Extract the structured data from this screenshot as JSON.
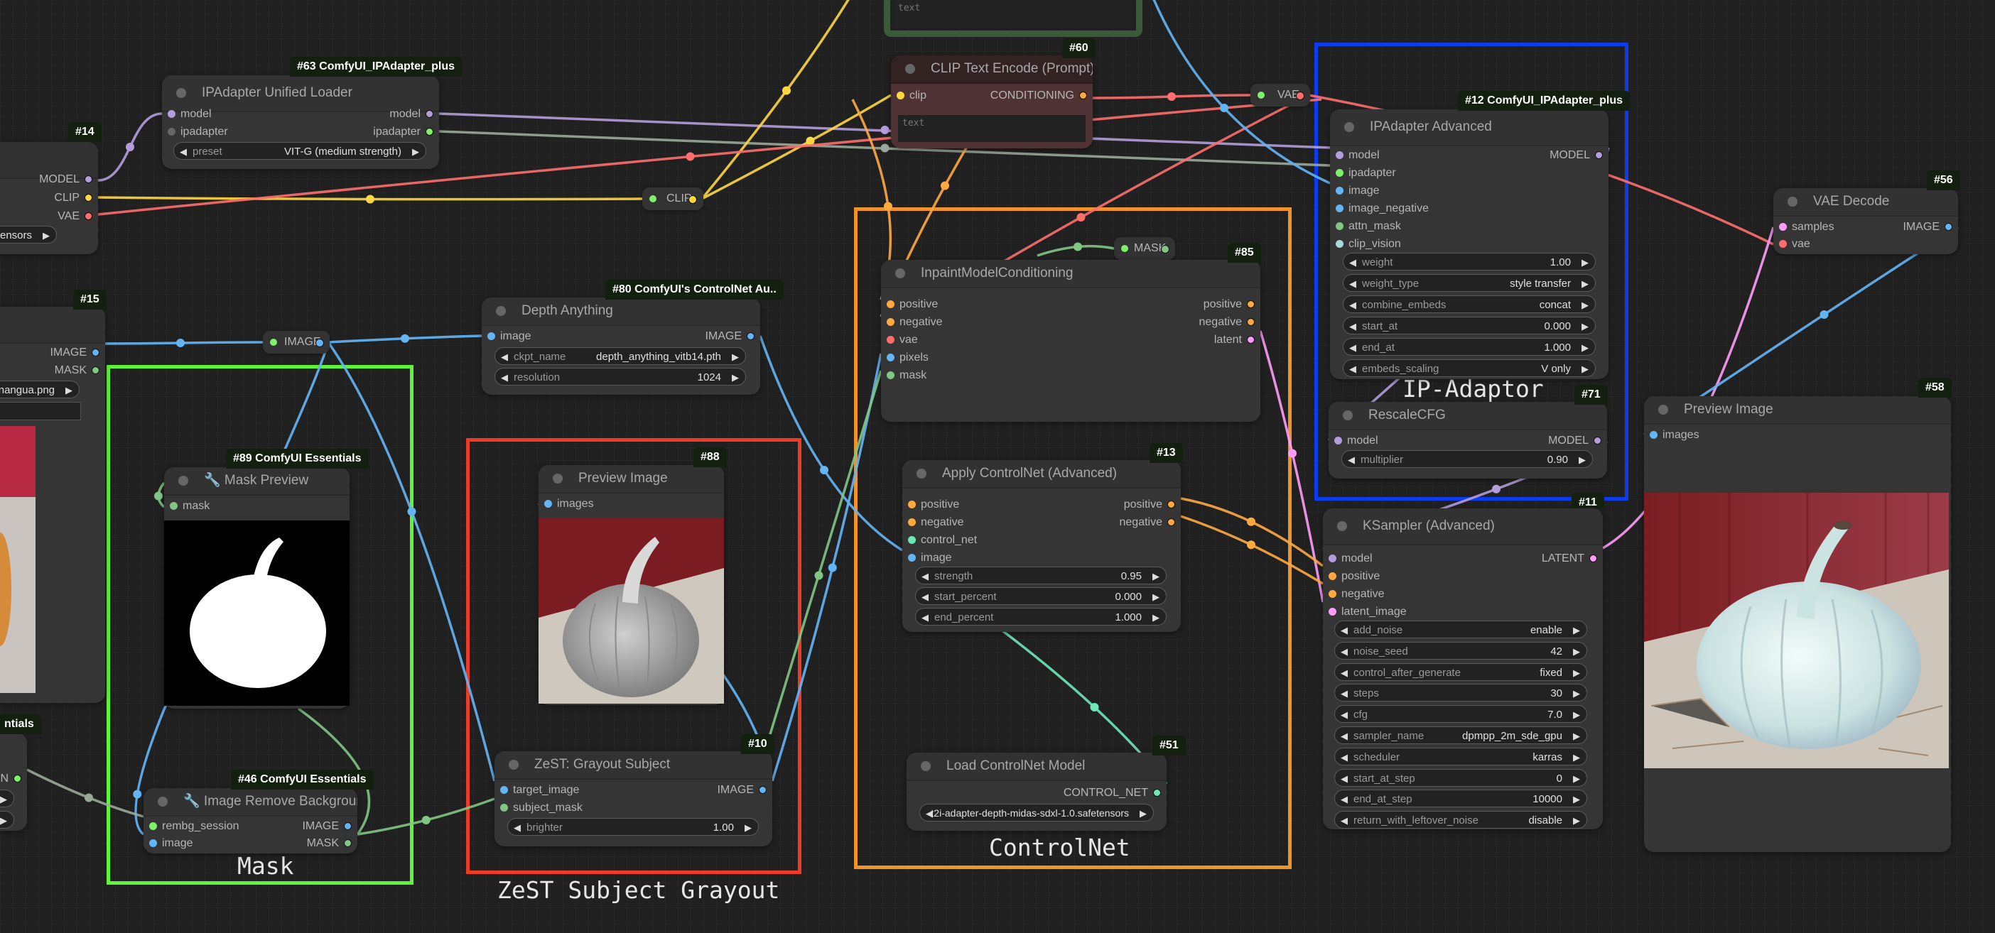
{
  "app": "ComfyUI workflow canvas",
  "colors": {
    "model": "#b39ddb",
    "clip": "#ffd740",
    "vae": "#ff6e6e",
    "conditioning": "#ffa940",
    "image": "#64b5f6",
    "mask": "#81c784",
    "ipadapter": "#9aa89a",
    "latent": "#ff9cf9",
    "control_net": "#6ee7b7",
    "clip_vision": "#a8dadc",
    "group_mask": "#5ff33b",
    "group_zest": "#ea3d24",
    "group_controlnet": "#f0932b",
    "group_ipadaptor": "#0c3cf0",
    "group_top": "#3b5a37"
  },
  "groups": {
    "mask": "Mask",
    "zest": "ZeST Subject Grayout",
    "controlnet": "ControlNet",
    "ipadaptor": "IP-Adaptor"
  },
  "reroutes": {
    "clip": "CLIP",
    "vae": "VAE",
    "image": "IMAGE",
    "mask": "MASK"
  },
  "nodes": {
    "n14": {
      "badge": "#14",
      "outputs": [
        "MODEL",
        "CLIP",
        "VAE"
      ],
      "widget_value": "safetensors"
    },
    "n63": {
      "badge": "#63 ComfyUI_IPAdapter_plus",
      "title": "IPAdapter Unified Loader",
      "inputs": [
        "model",
        "ipadapter"
      ],
      "outputs": [
        "model",
        "ipadapter"
      ],
      "widgets": [
        {
          "label": "preset",
          "value": "VIT-G (medium strength)"
        }
      ]
    },
    "n60": {
      "badge": "#60",
      "title": "CLIP Text Encode (Prompt)",
      "inputs": [
        "clip"
      ],
      "outputs": [
        "CONDITIONING"
      ],
      "text_placeholder": "text"
    },
    "top": {
      "text_placeholder": "text"
    },
    "n12": {
      "badge": "#12 ComfyUI_IPAdapter_plus",
      "title": "IPAdapter Advanced",
      "inputs": [
        "model",
        "ipadapter",
        "image",
        "image_negative",
        "attn_mask",
        "clip_vision"
      ],
      "outputs": [
        "MODEL"
      ],
      "widgets": [
        {
          "label": "weight",
          "value": "1.00"
        },
        {
          "label": "weight_type",
          "value": "style transfer"
        },
        {
          "label": "combine_embeds",
          "value": "concat"
        },
        {
          "label": "start_at",
          "value": "0.000"
        },
        {
          "label": "end_at",
          "value": "1.000"
        },
        {
          "label": "embeds_scaling",
          "value": "V only"
        }
      ]
    },
    "n71": {
      "badge": "#71",
      "title": "RescaleCFG",
      "inputs": [
        "model"
      ],
      "outputs": [
        "MODEL"
      ],
      "widgets": [
        {
          "label": "multiplier",
          "value": "0.90"
        }
      ]
    },
    "n11": {
      "badge": "#11",
      "title": "KSampler (Advanced)",
      "inputs": [
        "model",
        "positive",
        "negative",
        "latent_image"
      ],
      "outputs": [
        "LATENT"
      ],
      "widgets": [
        {
          "label": "add_noise",
          "value": "enable"
        },
        {
          "label": "noise_seed",
          "value": "42"
        },
        {
          "label": "control_after_generate",
          "value": "fixed"
        },
        {
          "label": "steps",
          "value": "30"
        },
        {
          "label": "cfg",
          "value": "7.0"
        },
        {
          "label": "sampler_name",
          "value": "dpmpp_2m_sde_gpu"
        },
        {
          "label": "scheduler",
          "value": "karras"
        },
        {
          "label": "start_at_step",
          "value": "0"
        },
        {
          "label": "end_at_step",
          "value": "10000"
        },
        {
          "label": "return_with_leftover_noise",
          "value": "disable"
        }
      ]
    },
    "n56": {
      "badge": "#56",
      "title": "VAE Decode",
      "inputs": [
        "samples",
        "vae"
      ],
      "outputs": [
        "IMAGE"
      ]
    },
    "n58": {
      "badge": "#58",
      "title": "Preview Image",
      "inputs": [
        "images"
      ],
      "image_alt": "glazed ceramic white pumpkin result"
    },
    "n15": {
      "badge": "#15",
      "outputs": [
        "IMAGE",
        "MASK"
      ],
      "widget_value": "nangua.png"
    },
    "n89": {
      "badge": "#89 ComfyUI Essentials",
      "title": "🔧 Mask Preview",
      "inputs": [
        "mask"
      ]
    },
    "n46": {
      "badge": "#46 ComfyUI Essentials",
      "title": "🔧 Image Remove Background",
      "inputs": [
        "rembg_session",
        "image"
      ],
      "outputs": [
        "IMAGE",
        "MASK"
      ]
    },
    "n53": {
      "badge": "ntials",
      "outputs": [
        "ON"
      ]
    },
    "n80": {
      "badge": "#80 ComfyUI's ControlNet Au..",
      "title": "Depth Anything",
      "inputs": [
        "image"
      ],
      "outputs": [
        "IMAGE"
      ],
      "widgets": [
        {
          "label": "ckpt_name",
          "value": "depth_anything_vitb14.pth"
        },
        {
          "label": "resolution",
          "value": "1024"
        }
      ]
    },
    "n88": {
      "badge": "#88",
      "title": "Preview Image",
      "inputs": [
        "images"
      ],
      "image_alt": "grayscale pumpkin"
    },
    "n10": {
      "badge": "#10",
      "title": "ZeST: Grayout Subject",
      "inputs": [
        "target_image",
        "subject_mask"
      ],
      "outputs": [
        "IMAGE"
      ],
      "widgets": [
        {
          "label": "brighter",
          "value": "1.00"
        }
      ]
    },
    "n85": {
      "badge": "#85",
      "title": "InpaintModelConditioning",
      "inputs": [
        "positive",
        "negative",
        "vae",
        "pixels",
        "mask"
      ],
      "outputs": [
        "positive",
        "negative",
        "latent"
      ]
    },
    "n13": {
      "badge": "#13",
      "title": "Apply ControlNet (Advanced)",
      "inputs": [
        "positive",
        "negative",
        "control_net",
        "image"
      ],
      "outputs": [
        "positive",
        "negative"
      ],
      "widgets": [
        {
          "label": "strength",
          "value": "0.95"
        },
        {
          "label": "start_percent",
          "value": "0.000"
        },
        {
          "label": "end_percent",
          "value": "1.000"
        }
      ]
    },
    "n51": {
      "badge": "#51",
      "title": "Load ControlNet Model",
      "outputs": [
        "CONTROL_NET"
      ],
      "widgets": [
        {
          "label": "control_net_name",
          "value": "t2i-adapter-depth-midas-sdxl-1.0.safetensors"
        }
      ]
    }
  }
}
